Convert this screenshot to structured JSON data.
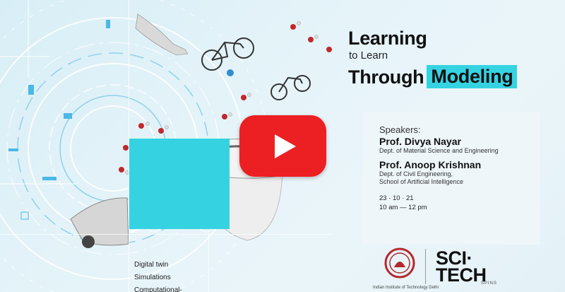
{
  "poster": {
    "title_line1": "Learning",
    "title_line2": "to Learn",
    "title_line3a": "Through",
    "title_line3b": "Modeling",
    "accent_color": "#35d3e2",
    "play_color": "#ec1f23"
  },
  "speakers": {
    "label": "Speakers:",
    "list": [
      {
        "name": "Prof. Divya Nayar",
        "dept1": "Dept. of Material Science and Engineering",
        "dept2": ""
      },
      {
        "name": "Prof. Anoop Krishnan",
        "dept1": "Dept. of Civil Engineering,",
        "dept2": "School of Artificial Intelligence"
      }
    ],
    "date": "23 · 10 · 21",
    "time": "10 am — 12 pm"
  },
  "topics": [
    "Digital twin",
    "Simulations",
    "Computational-"
  ],
  "logos": {
    "scitech_line1": "SCI·",
    "scitech_line2": "TECH",
    "spins": "SPINS",
    "iit_caption": "Indian Institute of Technology Delhi"
  },
  "icons": [
    "play-icon",
    "iit-seal-icon"
  ]
}
